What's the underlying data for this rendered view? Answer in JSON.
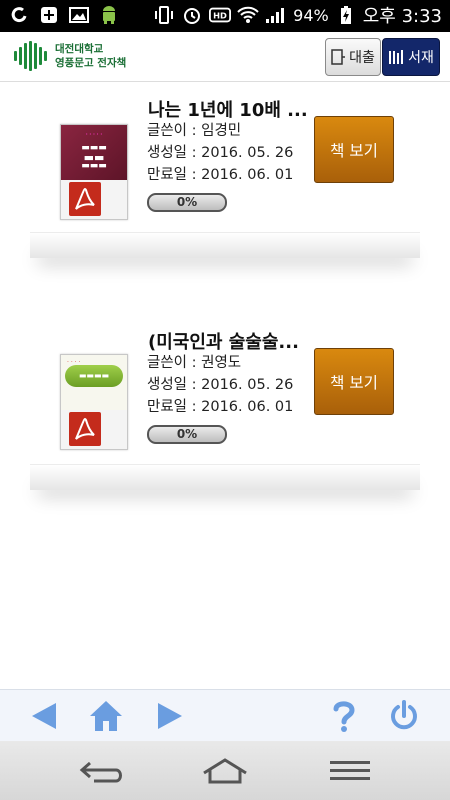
{
  "status_bar": {
    "battery": "94%",
    "time": "오후 3:33"
  },
  "header": {
    "logo_line1": "대전대학교",
    "logo_line2": "영풍문고 전자책",
    "btn_loan": "대출",
    "btn_library": "서재"
  },
  "books": [
    {
      "title": "나는 1년에 10배 ...",
      "author_label": "글쓴이 : ",
      "author": "임경민",
      "created_label": "생성일 : ",
      "created": "2016. 05. 26",
      "expires_label": "만료일 : ",
      "expires": "2016. 06. 01",
      "progress": "0%",
      "view_label": "책 보기",
      "cover_color": "#7a1f3a"
    },
    {
      "title": "(미국인과 술술술...",
      "author_label": "글쓴이 : ",
      "author": "권영도",
      "created_label": "생성일 : ",
      "created": "2016. 05. 26",
      "expires_label": "만료일 : ",
      "expires": "2016. 06. 01",
      "progress": "0%",
      "view_label": "책 보기",
      "cover_color": "#7fb23a"
    }
  ],
  "colors": {
    "accent_green": "#1e8a3a",
    "view_button": "#c27a10",
    "toolbar_icon": "#6a9de0"
  }
}
